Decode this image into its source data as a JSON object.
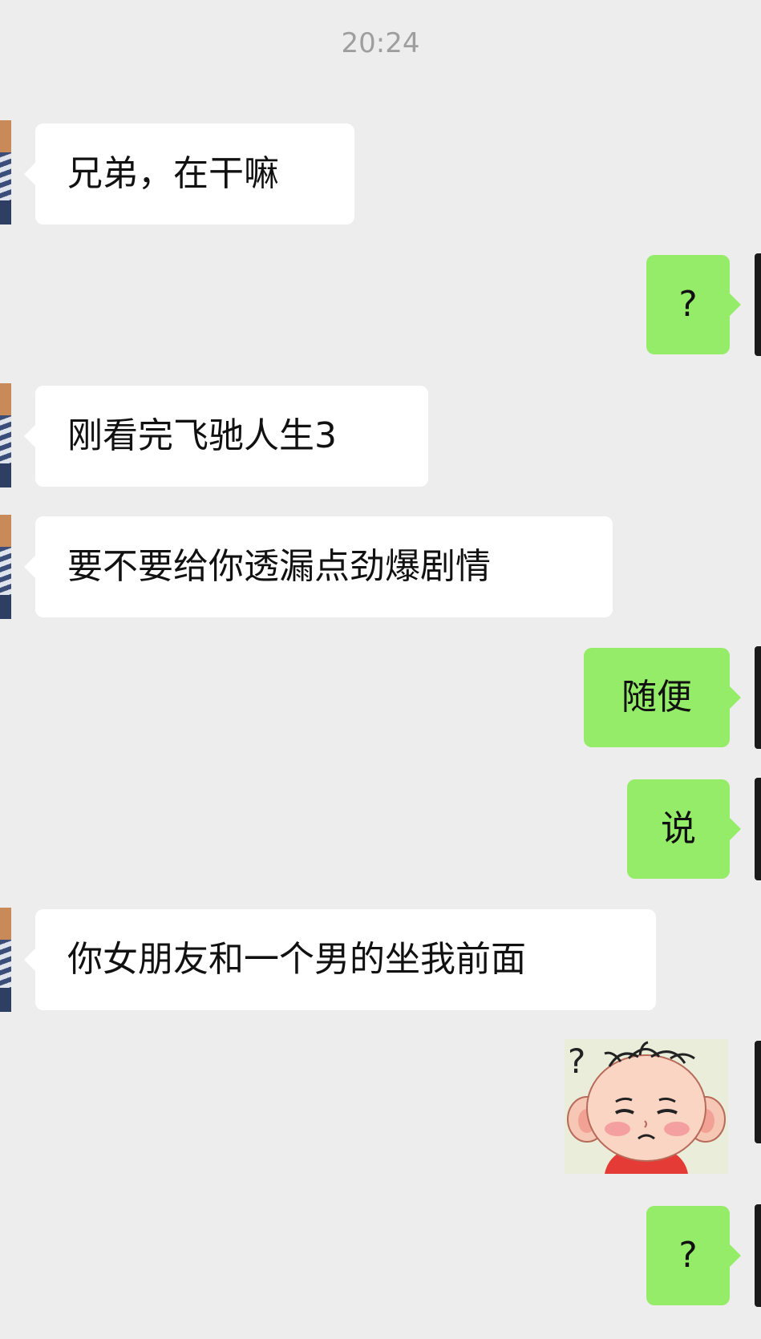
{
  "timestamp": "20:24",
  "messages": [
    {
      "side": "left",
      "text": "兄弟，在干嘛"
    },
    {
      "side": "right",
      "text": "?"
    },
    {
      "side": "left",
      "text": "刚看完飞驰人生3"
    },
    {
      "side": "left",
      "text": "要不要给你透漏点劲爆剧情"
    },
    {
      "side": "right",
      "text": "随便"
    },
    {
      "side": "right",
      "text": "说"
    },
    {
      "side": "left",
      "text": "你女朋友和一个男的坐我前面"
    },
    {
      "side": "right",
      "type": "sticker",
      "sticker_text": "?"
    },
    {
      "side": "right",
      "text": "?"
    }
  ],
  "colors": {
    "background": "#ededed",
    "incoming_bubble": "#ffffff",
    "outgoing_bubble": "#95ec69",
    "timestamp_text": "#9e9e9e"
  }
}
